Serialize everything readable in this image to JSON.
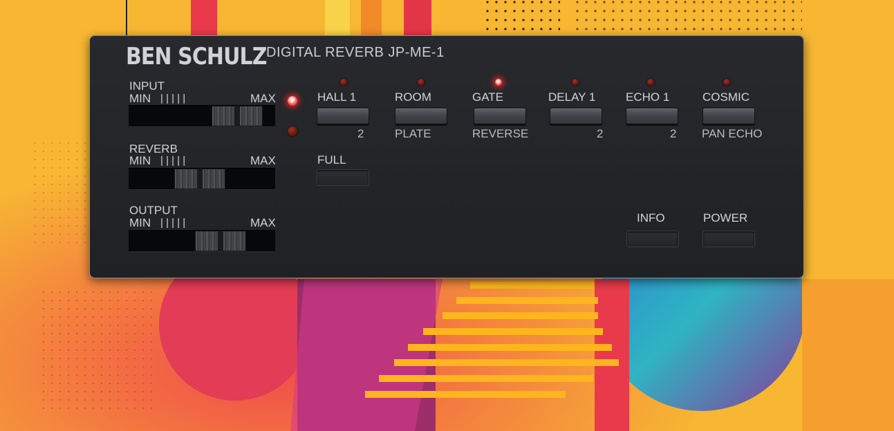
{
  "brand": "BEN SCHULZ",
  "model": "DIGITAL REVERB JP-ME-1",
  "faders": [
    {
      "label": "INPUT",
      "min": "MIN",
      "max": "MAX",
      "ticks": "|     |    |    |    |",
      "level": 0.6
    },
    {
      "label": "REVERB",
      "min": "MIN",
      "max": "MAX",
      "ticks": "|     |    |    |    |",
      "level": 0.35
    },
    {
      "label": "OUTPUT",
      "min": "MIN",
      "max": "MAX",
      "ticks": "|     |    |    |    |",
      "level": 0.45
    }
  ],
  "modes": [
    {
      "primary": "HALL 1",
      "secondary": "2",
      "active": false
    },
    {
      "primary": "ROOM",
      "secondary": "PLATE",
      "active": false
    },
    {
      "primary": "GATE",
      "secondary": "REVERSE",
      "active": true
    },
    {
      "primary": "DELAY 1",
      "secondary": "2",
      "active": false
    },
    {
      "primary": "ECHO 1",
      "secondary": "2",
      "active": false
    },
    {
      "primary": "COSMIC",
      "secondary": "PAN ECHO",
      "active": false
    }
  ],
  "full_label": "FULL",
  "info_label": "INFO",
  "power_label": "POWER",
  "input_indicators": {
    "top_on": true,
    "bottom_on": false
  },
  "colors": {
    "panel": "#232528",
    "led_on": "#ff3a3a",
    "background": "#f7b733"
  }
}
